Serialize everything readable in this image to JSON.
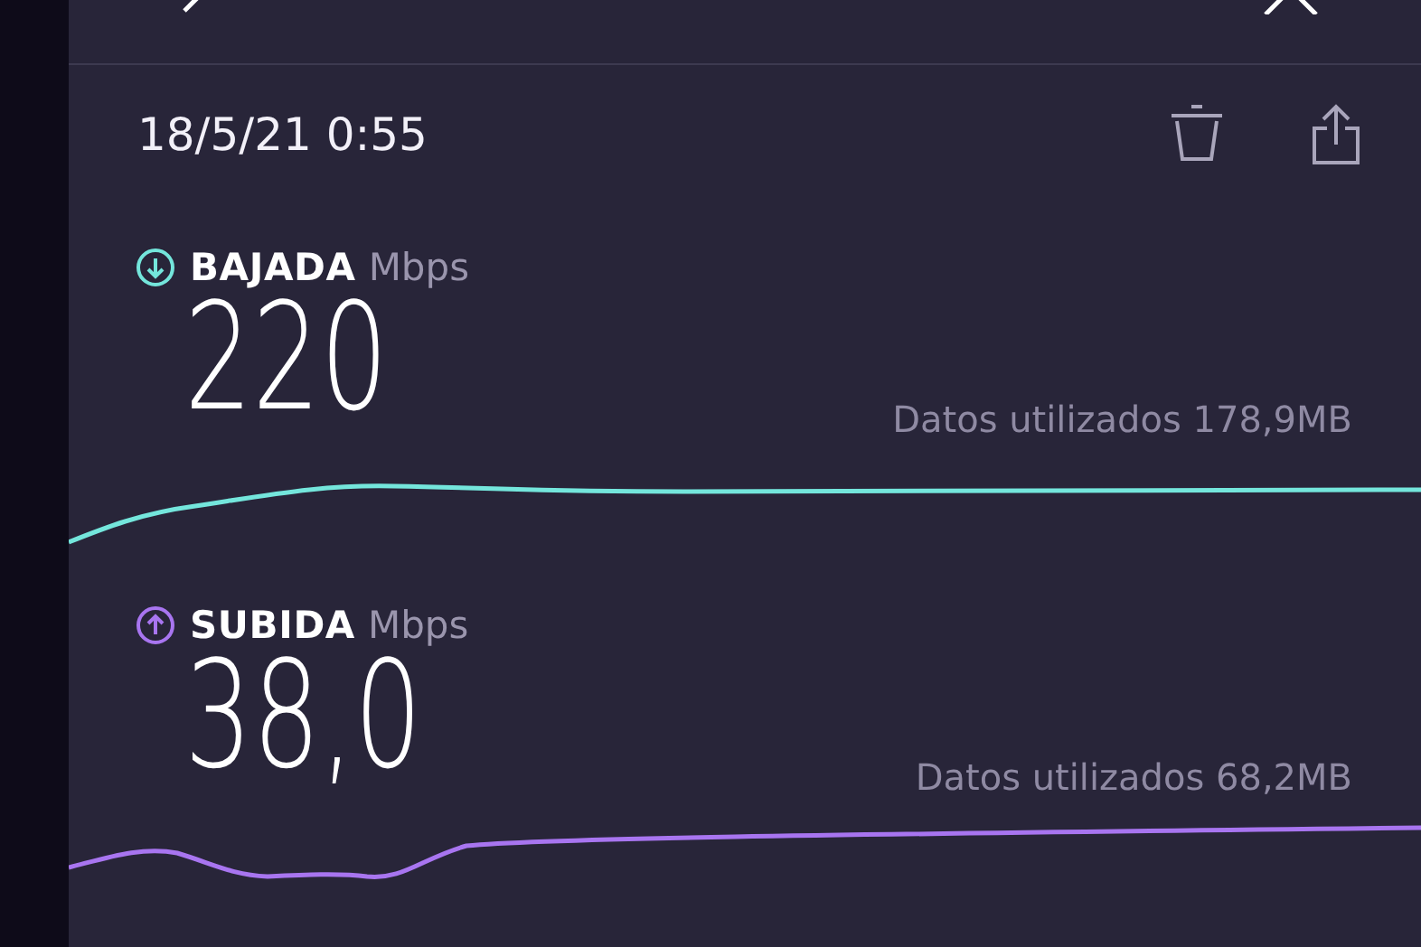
{
  "result": {
    "date": "18/5/21 0:55"
  },
  "metrics": [
    {
      "kind": "download",
      "label": "BAJADA",
      "unit": "Mbps",
      "value": "220",
      "data_used": "Datos utilizados 178,9MB",
      "color": "#74e6dc"
    },
    {
      "kind": "upload",
      "label": "SUBIDA",
      "unit": "Mbps",
      "value": "38,0",
      "data_used": "Datos utilizados 68,2MB",
      "color": "#a875f0"
    }
  ]
}
